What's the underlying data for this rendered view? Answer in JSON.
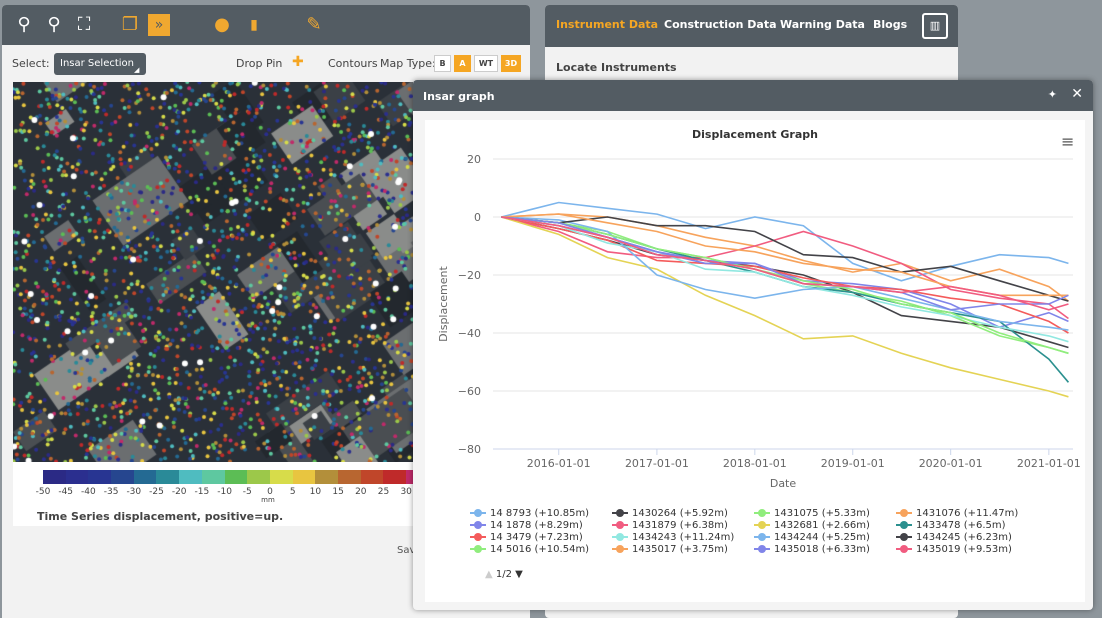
{
  "toolbar": {
    "icons": [
      "zoom-in-icon",
      "zoom-out-icon",
      "zoom-extent-icon",
      "copy-layers-icon",
      "forward-icon",
      "light-bulb-icon",
      "pin-marker-icon",
      "pencil-icon"
    ]
  },
  "select_row": {
    "select_label": "Select:",
    "select_value": "Insar Selection",
    "drop_pin": "Drop Pin",
    "contours": "Contours",
    "map_type_label": "Map Type:",
    "map_types": [
      {
        "label": "B",
        "active": false
      },
      {
        "label": "A",
        "active": true
      },
      {
        "label": "WT",
        "active": false
      },
      {
        "label": "3D",
        "active": true
      }
    ]
  },
  "colorbar": {
    "ticks": [
      "-50",
      "-45",
      "-40",
      "-35",
      "-30",
      "-25",
      "-20",
      "-15",
      "-10",
      "-5",
      "0",
      "5",
      "10",
      "15",
      "20",
      "25",
      "30"
    ],
    "unit": "mm",
    "colors": [
      "#2b2a85",
      "#2b2f8f",
      "#283592",
      "#26468f",
      "#246a93",
      "#2a8a98",
      "#4fbcc0",
      "#5ec8a0",
      "#5cbd55",
      "#9cc84a",
      "#d7dc4a",
      "#e8c540",
      "#b38f3a",
      "#b86630",
      "#c0462a",
      "#bf2a2a",
      "#c02a6a"
    ],
    "caption": "Time Series displacement, positive=up."
  },
  "left_footer": {
    "save_label": "Sav"
  },
  "right_panel": {
    "tabs": [
      "Instrument Data",
      "Construction Data",
      "Warning Data",
      "Blogs"
    ],
    "active_tab": "Instrument Data",
    "section_title": "Locate Instruments"
  },
  "popup": {
    "title": "Insar graph",
    "page_indicator": "1/2"
  },
  "chart_data": {
    "type": "line",
    "title": "Displacement Graph",
    "xlabel": "Date",
    "ylabel": "Displacement",
    "ylim": [
      -80,
      20
    ],
    "yticks": [
      "20",
      "0",
      "−20",
      "−40",
      "−60",
      "−80"
    ],
    "xticks": [
      "2016-01-01",
      "2017-01-01",
      "2018-01-01",
      "2019-01-01",
      "2020-01-01",
      "2021-01-01"
    ],
    "grid": true,
    "legend": "bottom",
    "x": [
      "2015-06-01",
      "2016-01-01",
      "2016-07-01",
      "2017-01-01",
      "2017-07-01",
      "2018-01-01",
      "2018-07-01",
      "2019-01-01",
      "2019-07-01",
      "2020-01-01",
      "2020-07-01",
      "2021-01-01",
      "2021-03-15"
    ],
    "series": [
      {
        "name": "14 8793 (+10.85m)",
        "color": "#7cb5ec",
        "values": [
          0,
          5,
          3,
          1,
          -4,
          0,
          -3,
          -16,
          -22,
          -17,
          -13,
          -14,
          -16
        ]
      },
      {
        "name": "1430264 (+5.92m)",
        "color": "#434348",
        "values": [
          0,
          -4,
          -8,
          -13,
          -15,
          -17,
          -20,
          -26,
          -34,
          -36,
          -38,
          -43,
          -45
        ]
      },
      {
        "name": "1431075 (+5.33m)",
        "color": "#90ed7d",
        "values": [
          0,
          -2,
          -5,
          -11,
          -14,
          -18,
          -23,
          -26,
          -29,
          -34,
          -41,
          -45,
          -47
        ]
      },
      {
        "name": "1431076 (+11.47m)",
        "color": "#f7a35c",
        "values": [
          0,
          1,
          0,
          -3,
          -7,
          -10,
          -15,
          -19,
          -16,
          -22,
          -18,
          -24,
          -29
        ]
      },
      {
        "name": "14 1878 (+8.29m)",
        "color": "#8085e9",
        "values": [
          0,
          -3,
          -7,
          -12,
          -15,
          -16,
          -22,
          -23,
          -25,
          -30,
          -38,
          -33,
          -36
        ]
      },
      {
        "name": "1431879 (+6.38m)",
        "color": "#f15c80",
        "values": [
          0,
          -5,
          -12,
          -14,
          -14,
          -10,
          -5,
          -10,
          -16,
          -25,
          -28,
          -30,
          -35
        ]
      },
      {
        "name": "1432681 (+2.66m)",
        "color": "#e4d354",
        "values": [
          0,
          -6,
          -14,
          -18,
          -27,
          -34,
          -42,
          -41,
          -47,
          -52,
          -56,
          -60,
          -62
        ]
      },
      {
        "name": "1433478 (+6.5m)",
        "color": "#2b908f",
        "values": [
          0,
          -2,
          -6,
          -11,
          -15,
          -19,
          -24,
          -26,
          -30,
          -33,
          -36,
          -49,
          -57
        ]
      },
      {
        "name": "14 3479 (+7.23m)",
        "color": "#f45b5b",
        "values": [
          0,
          -4,
          -8,
          -15,
          -16,
          -17,
          -21,
          -24,
          -25,
          -28,
          -30,
          -36,
          -40
        ]
      },
      {
        "name": "1434243 (+11.24m)",
        "color": "#91e8e1",
        "values": [
          0,
          -3,
          -9,
          -12,
          -18,
          -19,
          -24,
          -27,
          -31,
          -34,
          -38,
          -41,
          -43
        ]
      },
      {
        "name": "1434244 (+5.25m)",
        "color": "#7cb5ec",
        "values": [
          0,
          -1,
          -5,
          -20,
          -25,
          -28,
          -25,
          -24,
          -28,
          -32,
          -36,
          -38,
          -39
        ]
      },
      {
        "name": "1434245 (+6.23m)",
        "color": "#434348",
        "values": [
          0,
          -2,
          0,
          -3,
          -3,
          -5,
          -13,
          -14,
          -19,
          -17,
          -22,
          -27,
          -29
        ]
      },
      {
        "name": "14 5016 (+10.54m)",
        "color": "#90ed7d",
        "values": [
          0,
          -2,
          -6,
          -11,
          -14,
          -18,
          -22,
          -25,
          -30,
          -33,
          -40,
          -45,
          -47
        ]
      },
      {
        "name": "1435017 (+3.75m)",
        "color": "#f7a35c",
        "values": [
          0,
          1,
          -2,
          -5,
          -10,
          -12,
          -16,
          -18,
          -19,
          -24,
          -27,
          -27,
          -27
        ]
      },
      {
        "name": "1435018 (+6.33m)",
        "color": "#8085e9",
        "values": [
          0,
          -2,
          -7,
          -12,
          -16,
          -16,
          -23,
          -24,
          -26,
          -32,
          -30,
          -30,
          -27
        ]
      },
      {
        "name": "1435019 (+9.53m)",
        "color": "#f15c80",
        "values": [
          0,
          -3,
          -7,
          -13,
          -15,
          -18,
          -23,
          -24,
          -26,
          -24,
          -27,
          -32,
          -30
        ]
      }
    ]
  }
}
